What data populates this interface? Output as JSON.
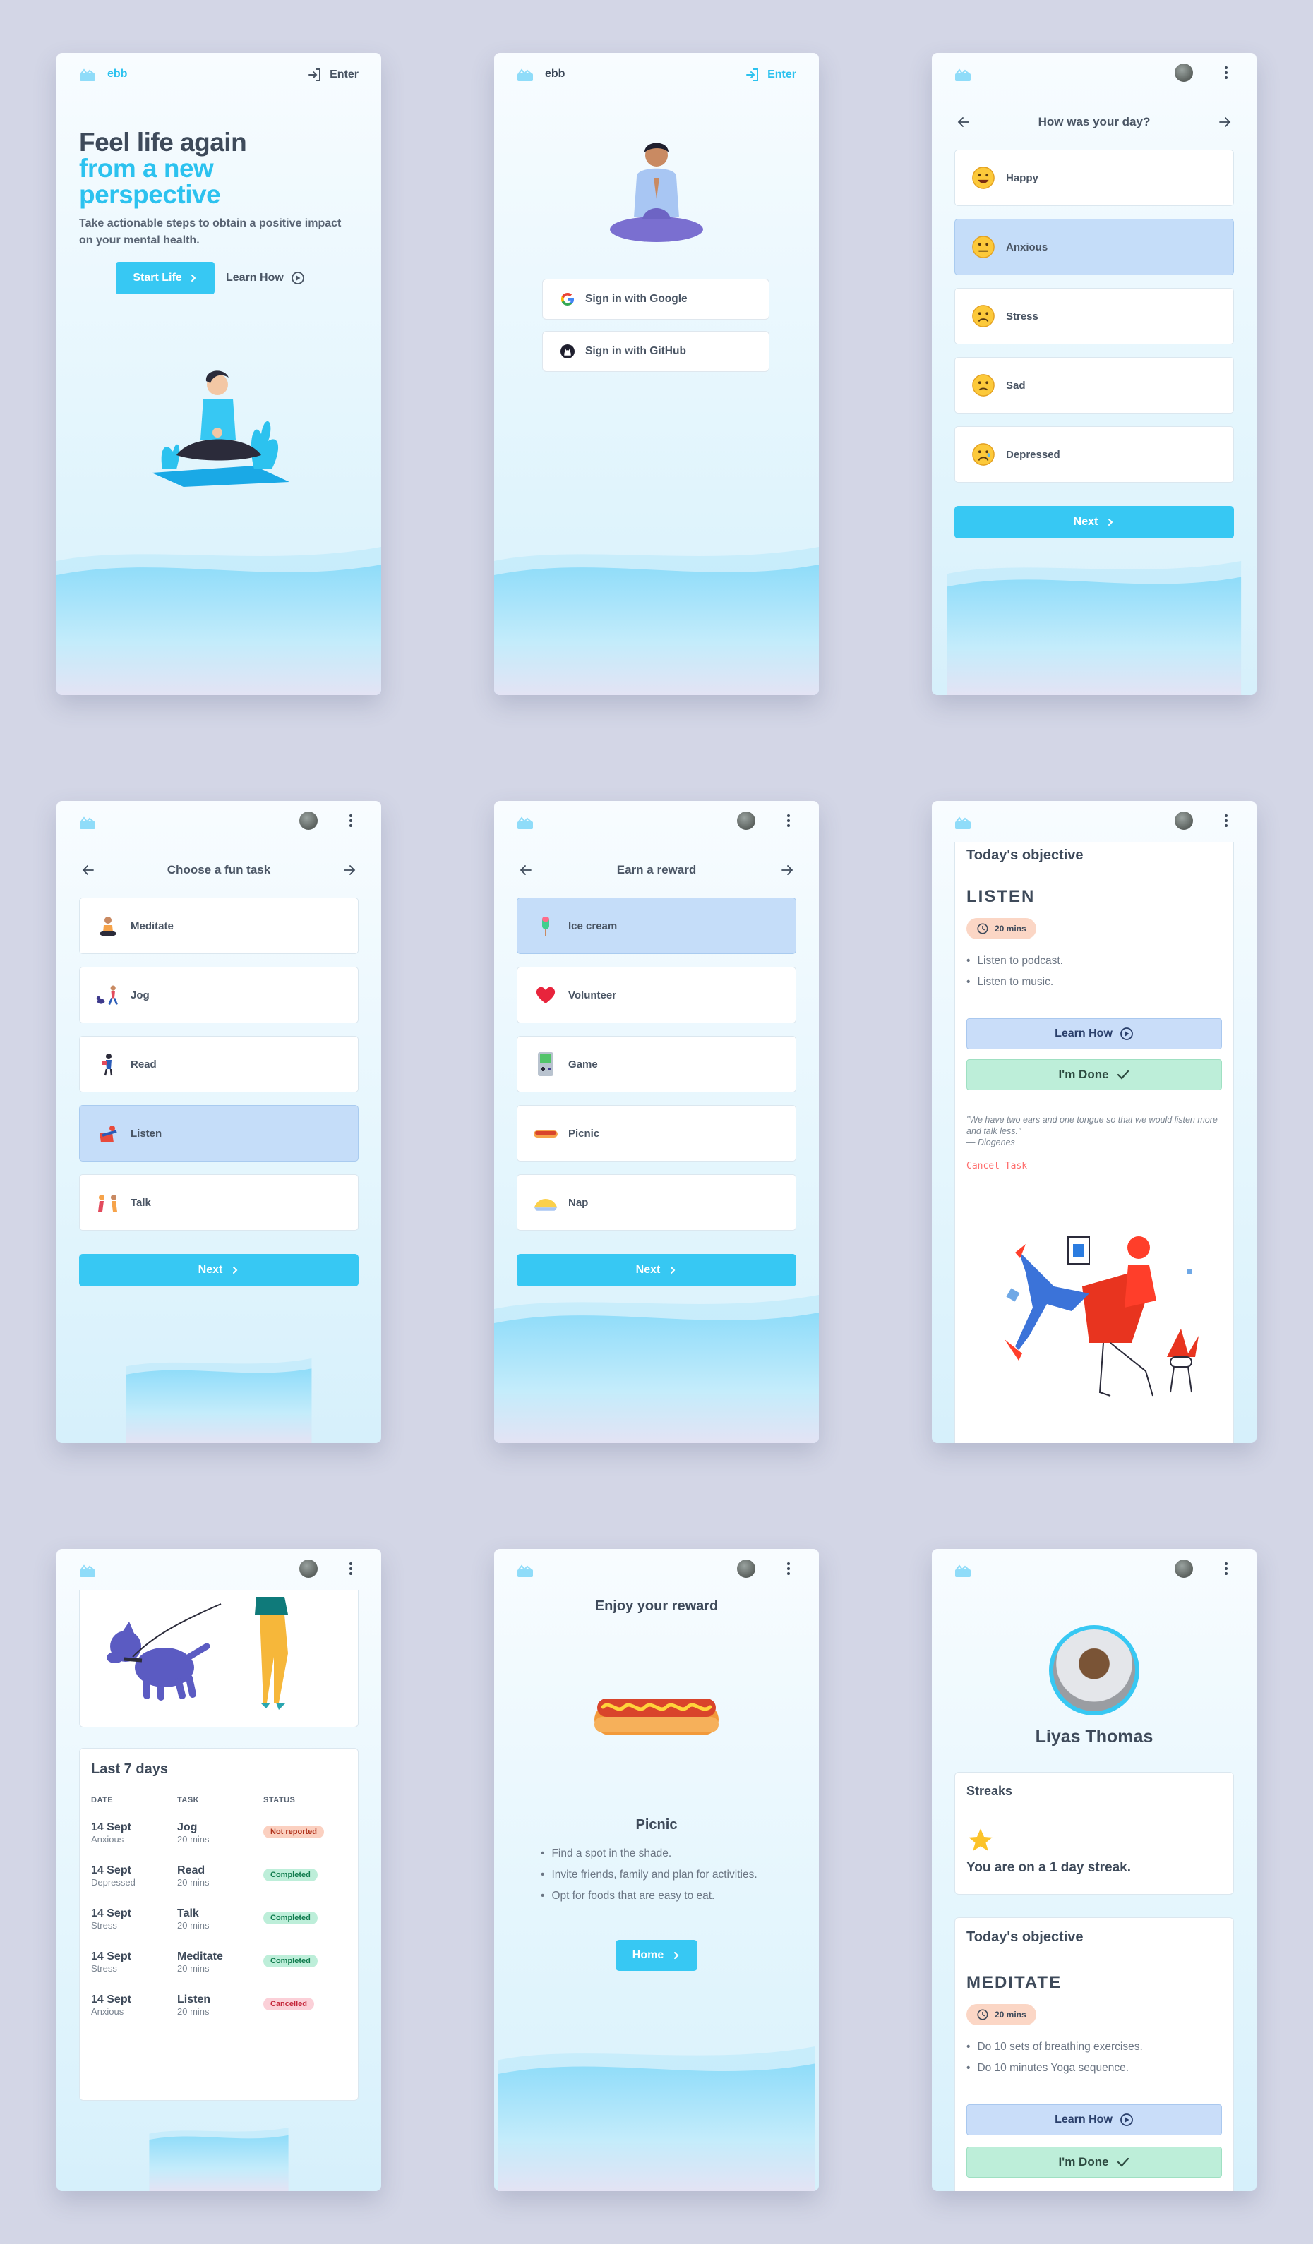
{
  "brand": {
    "name": "ebb"
  },
  "colors": {
    "accent": "#37c8f3",
    "selected": "#c5ddf9",
    "done": "#bdeed9",
    "learn": "#c9ddf9",
    "background": "#d3d6e6"
  },
  "landing": {
    "enter_label": "Enter",
    "headline_line1": "Feel life again",
    "headline_line2": "from a new",
    "headline_line3": "perspective",
    "subtitle": "Take actionable steps to obtain a positive impact on your mental health.",
    "start_label": "Start Life",
    "learn_label": "Learn How"
  },
  "signin": {
    "enter_label": "Enter",
    "google_label": "Sign in with Google",
    "github_label": "Sign in with GitHub"
  },
  "mood": {
    "title": "How was your day?",
    "options": [
      {
        "label": "Happy",
        "icon": "happy-emoji-icon"
      },
      {
        "label": "Anxious",
        "icon": "anxious-emoji-icon",
        "selected": true
      },
      {
        "label": "Stress",
        "icon": "stress-emoji-icon"
      },
      {
        "label": "Sad",
        "icon": "sad-emoji-icon"
      },
      {
        "label": "Depressed",
        "icon": "depressed-emoji-icon"
      }
    ],
    "next_label": "Next"
  },
  "tasks": {
    "title": "Choose a fun task",
    "options": [
      {
        "label": "Meditate",
        "icon": "meditate-icon"
      },
      {
        "label": "Jog",
        "icon": "jog-icon"
      },
      {
        "label": "Read",
        "icon": "read-icon"
      },
      {
        "label": "Listen",
        "icon": "listen-icon",
        "selected": true
      },
      {
        "label": "Talk",
        "icon": "talk-icon"
      }
    ],
    "next_label": "Next"
  },
  "rewards": {
    "title": "Earn a reward",
    "options": [
      {
        "label": "Ice cream",
        "icon": "ice-cream-icon",
        "selected": true
      },
      {
        "label": "Volunteer",
        "icon": "heart-icon"
      },
      {
        "label": "Game",
        "icon": "gameboy-icon"
      },
      {
        "label": "Picnic",
        "icon": "hotdog-icon"
      },
      {
        "label": "Nap",
        "icon": "pillow-icon"
      }
    ],
    "next_label": "Next"
  },
  "objective": {
    "heading": "Today's objective",
    "task": "LISTEN",
    "duration": "20 mins",
    "steps": [
      "Listen to podcast.",
      "Listen to music."
    ],
    "learn_label": "Learn How",
    "done_label": "I'm Done",
    "quote": "\"We have two ears and one tongue so that we would listen more and talk less.\"",
    "quote_author": "— Diogenes",
    "cancel_label": "Cancel Task"
  },
  "history": {
    "title": "Last 7 days",
    "columns": [
      "DATE",
      "TASK",
      "STATUS"
    ],
    "rows": [
      {
        "date": "14 Sept",
        "mood": "Anxious",
        "task": "Jog",
        "duration": "20 mins",
        "status": "Not reported",
        "kind": "nr"
      },
      {
        "date": "14 Sept",
        "mood": "Depressed",
        "task": "Read",
        "duration": "20 mins",
        "status": "Completed",
        "kind": "c"
      },
      {
        "date": "14 Sept",
        "mood": "Stress",
        "task": "Talk",
        "duration": "20 mins",
        "status": "Completed",
        "kind": "c"
      },
      {
        "date": "14 Sept",
        "mood": "Stress",
        "task": "Meditate",
        "duration": "20 mins",
        "status": "Completed",
        "kind": "c"
      },
      {
        "date": "14 Sept",
        "mood": "Anxious",
        "task": "Listen",
        "duration": "20 mins",
        "status": "Cancelled",
        "kind": "x"
      }
    ]
  },
  "reward_result": {
    "title": "Enjoy your reward",
    "name": "Picnic",
    "tips": [
      "Find a spot in the shade.",
      "Invite friends, family and plan for activities.",
      "Opt for foods that are easy to eat."
    ],
    "home_label": "Home"
  },
  "profile": {
    "name": "Liyas Thomas",
    "streaks_title": "Streaks",
    "streak_text": "You are on a 1 day streak.",
    "objective_heading": "Today's objective",
    "task": "MEDITATE",
    "duration": "20 mins",
    "steps": [
      "Do 10 sets of breathing exercises.",
      "Do 10 minutes Yoga sequence."
    ],
    "learn_label": "Learn How",
    "done_label": "I'm Done"
  }
}
